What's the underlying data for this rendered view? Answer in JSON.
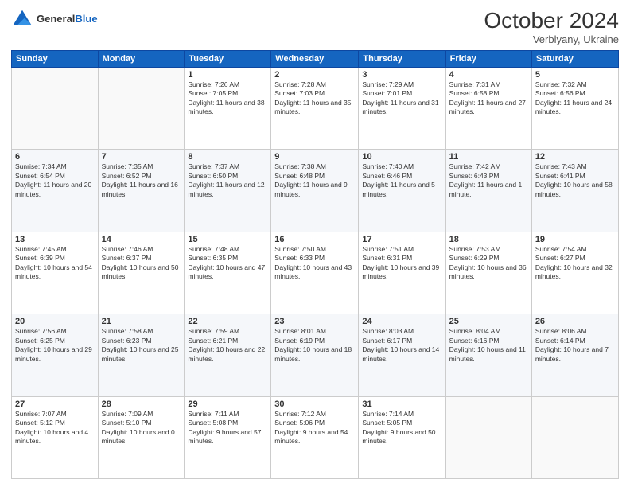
{
  "header": {
    "logo": {
      "general": "General",
      "blue": "Blue"
    },
    "title": "October 2024",
    "location": "Verblyany, Ukraine"
  },
  "days_of_week": [
    "Sunday",
    "Monday",
    "Tuesday",
    "Wednesday",
    "Thursday",
    "Friday",
    "Saturday"
  ],
  "weeks": [
    [
      {
        "day": "",
        "info": ""
      },
      {
        "day": "",
        "info": ""
      },
      {
        "day": "1",
        "sunrise": "Sunrise: 7:26 AM",
        "sunset": "Sunset: 7:05 PM",
        "daylight": "Daylight: 11 hours and 38 minutes."
      },
      {
        "day": "2",
        "sunrise": "Sunrise: 7:28 AM",
        "sunset": "Sunset: 7:03 PM",
        "daylight": "Daylight: 11 hours and 35 minutes."
      },
      {
        "day": "3",
        "sunrise": "Sunrise: 7:29 AM",
        "sunset": "Sunset: 7:01 PM",
        "daylight": "Daylight: 11 hours and 31 minutes."
      },
      {
        "day": "4",
        "sunrise": "Sunrise: 7:31 AM",
        "sunset": "Sunset: 6:58 PM",
        "daylight": "Daylight: 11 hours and 27 minutes."
      },
      {
        "day": "5",
        "sunrise": "Sunrise: 7:32 AM",
        "sunset": "Sunset: 6:56 PM",
        "daylight": "Daylight: 11 hours and 24 minutes."
      }
    ],
    [
      {
        "day": "6",
        "sunrise": "Sunrise: 7:34 AM",
        "sunset": "Sunset: 6:54 PM",
        "daylight": "Daylight: 11 hours and 20 minutes."
      },
      {
        "day": "7",
        "sunrise": "Sunrise: 7:35 AM",
        "sunset": "Sunset: 6:52 PM",
        "daylight": "Daylight: 11 hours and 16 minutes."
      },
      {
        "day": "8",
        "sunrise": "Sunrise: 7:37 AM",
        "sunset": "Sunset: 6:50 PM",
        "daylight": "Daylight: 11 hours and 12 minutes."
      },
      {
        "day": "9",
        "sunrise": "Sunrise: 7:38 AM",
        "sunset": "Sunset: 6:48 PM",
        "daylight": "Daylight: 11 hours and 9 minutes."
      },
      {
        "day": "10",
        "sunrise": "Sunrise: 7:40 AM",
        "sunset": "Sunset: 6:46 PM",
        "daylight": "Daylight: 11 hours and 5 minutes."
      },
      {
        "day": "11",
        "sunrise": "Sunrise: 7:42 AM",
        "sunset": "Sunset: 6:43 PM",
        "daylight": "Daylight: 11 hours and 1 minute."
      },
      {
        "day": "12",
        "sunrise": "Sunrise: 7:43 AM",
        "sunset": "Sunset: 6:41 PM",
        "daylight": "Daylight: 10 hours and 58 minutes."
      }
    ],
    [
      {
        "day": "13",
        "sunrise": "Sunrise: 7:45 AM",
        "sunset": "Sunset: 6:39 PM",
        "daylight": "Daylight: 10 hours and 54 minutes."
      },
      {
        "day": "14",
        "sunrise": "Sunrise: 7:46 AM",
        "sunset": "Sunset: 6:37 PM",
        "daylight": "Daylight: 10 hours and 50 minutes."
      },
      {
        "day": "15",
        "sunrise": "Sunrise: 7:48 AM",
        "sunset": "Sunset: 6:35 PM",
        "daylight": "Daylight: 10 hours and 47 minutes."
      },
      {
        "day": "16",
        "sunrise": "Sunrise: 7:50 AM",
        "sunset": "Sunset: 6:33 PM",
        "daylight": "Daylight: 10 hours and 43 minutes."
      },
      {
        "day": "17",
        "sunrise": "Sunrise: 7:51 AM",
        "sunset": "Sunset: 6:31 PM",
        "daylight": "Daylight: 10 hours and 39 minutes."
      },
      {
        "day": "18",
        "sunrise": "Sunrise: 7:53 AM",
        "sunset": "Sunset: 6:29 PM",
        "daylight": "Daylight: 10 hours and 36 minutes."
      },
      {
        "day": "19",
        "sunrise": "Sunrise: 7:54 AM",
        "sunset": "Sunset: 6:27 PM",
        "daylight": "Daylight: 10 hours and 32 minutes."
      }
    ],
    [
      {
        "day": "20",
        "sunrise": "Sunrise: 7:56 AM",
        "sunset": "Sunset: 6:25 PM",
        "daylight": "Daylight: 10 hours and 29 minutes."
      },
      {
        "day": "21",
        "sunrise": "Sunrise: 7:58 AM",
        "sunset": "Sunset: 6:23 PM",
        "daylight": "Daylight: 10 hours and 25 minutes."
      },
      {
        "day": "22",
        "sunrise": "Sunrise: 7:59 AM",
        "sunset": "Sunset: 6:21 PM",
        "daylight": "Daylight: 10 hours and 22 minutes."
      },
      {
        "day": "23",
        "sunrise": "Sunrise: 8:01 AM",
        "sunset": "Sunset: 6:19 PM",
        "daylight": "Daylight: 10 hours and 18 minutes."
      },
      {
        "day": "24",
        "sunrise": "Sunrise: 8:03 AM",
        "sunset": "Sunset: 6:17 PM",
        "daylight": "Daylight: 10 hours and 14 minutes."
      },
      {
        "day": "25",
        "sunrise": "Sunrise: 8:04 AM",
        "sunset": "Sunset: 6:16 PM",
        "daylight": "Daylight: 10 hours and 11 minutes."
      },
      {
        "day": "26",
        "sunrise": "Sunrise: 8:06 AM",
        "sunset": "Sunset: 6:14 PM",
        "daylight": "Daylight: 10 hours and 7 minutes."
      }
    ],
    [
      {
        "day": "27",
        "sunrise": "Sunrise: 7:07 AM",
        "sunset": "Sunset: 5:12 PM",
        "daylight": "Daylight: 10 hours and 4 minutes."
      },
      {
        "day": "28",
        "sunrise": "Sunrise: 7:09 AM",
        "sunset": "Sunset: 5:10 PM",
        "daylight": "Daylight: 10 hours and 0 minutes."
      },
      {
        "day": "29",
        "sunrise": "Sunrise: 7:11 AM",
        "sunset": "Sunset: 5:08 PM",
        "daylight": "Daylight: 9 hours and 57 minutes."
      },
      {
        "day": "30",
        "sunrise": "Sunrise: 7:12 AM",
        "sunset": "Sunset: 5:06 PM",
        "daylight": "Daylight: 9 hours and 54 minutes."
      },
      {
        "day": "31",
        "sunrise": "Sunrise: 7:14 AM",
        "sunset": "Sunset: 5:05 PM",
        "daylight": "Daylight: 9 hours and 50 minutes."
      },
      {
        "day": "",
        "info": ""
      },
      {
        "day": "",
        "info": ""
      }
    ]
  ]
}
